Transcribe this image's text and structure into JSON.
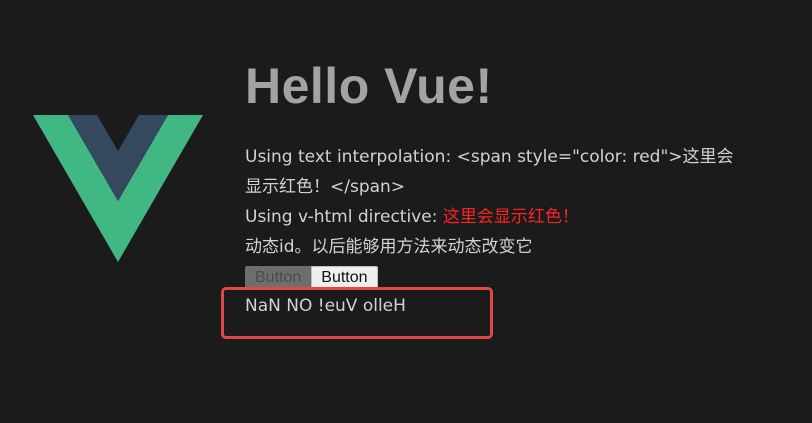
{
  "header": {
    "title": "Hello Vue!"
  },
  "logo": {
    "icon": "vue-logo-icon",
    "colors": {
      "outer": "#41b883",
      "inner": "#34495e"
    }
  },
  "content": {
    "text_interpolation": "Using text interpolation: <span style=\"color: red\">这里会显示红色！</span>",
    "vhtml_label": "Using v-html directive: ",
    "vhtml_red_text": "这里会显示红色！",
    "dynamic_id_text": "动态id。以后能够用方法来动态改变它",
    "buttons": [
      {
        "label": "Button",
        "state": "disabled"
      },
      {
        "label": "Button",
        "state": "enabled"
      }
    ],
    "reversed_message": "NaN NO !euV olleH"
  },
  "colors": {
    "background": "#1b1b1b",
    "highlight": "#e04848",
    "red_text": "#ff2222"
  }
}
